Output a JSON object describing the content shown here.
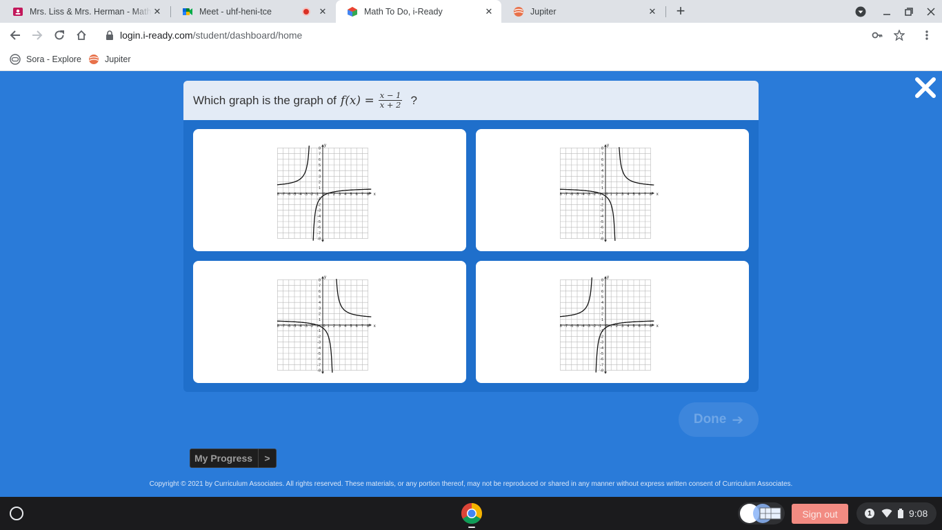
{
  "browser": {
    "tabs": [
      {
        "title": "Mrs. Liss & Mrs. Herman - Math -",
        "icon": "classroom-icon",
        "active": false
      },
      {
        "title": "Meet - uhf-heni-tce",
        "icon": "meet-icon",
        "active": false,
        "recording": true
      },
      {
        "title": "Math To Do, i-Ready",
        "icon": "iready-icon",
        "active": true
      },
      {
        "title": "Jupiter",
        "icon": "jupiter-icon",
        "active": false
      }
    ],
    "url": {
      "domain": "login.i-ready.com",
      "path": "/student/dashboard/home"
    },
    "bookmarks": [
      {
        "label": "Sora - Explore",
        "icon": "sora-icon"
      },
      {
        "label": "Jupiter",
        "icon": "jupiter-icon"
      }
    ]
  },
  "question": {
    "prefix": "Which graph is the graph of",
    "function_name": "f(x) =",
    "numerator": "x − 1",
    "denominator": "x + 2",
    "suffix": "?"
  },
  "choices": [
    {
      "id": "A",
      "left_branch": "above",
      "right_branch": "below"
    },
    {
      "id": "B",
      "left_branch": "below",
      "right_branch": "above"
    },
    {
      "id": "C",
      "left_branch": "below",
      "right_branch": "above"
    },
    {
      "id": "D",
      "left_branch": "above",
      "right_branch": "below"
    }
  ],
  "graph": {
    "axis_labels": {
      "x": "x",
      "y": "y"
    },
    "x_ticks": [
      "-8",
      "-7",
      "-6",
      "-5",
      "-4",
      "-3",
      "-2",
      "-1",
      "0",
      "1",
      "2",
      "3",
      "4",
      "5",
      "6",
      "7",
      "8"
    ],
    "y_ticks": [
      "8",
      "7",
      "6",
      "5",
      "4",
      "3",
      "2",
      "1",
      "-1",
      "-2",
      "-3",
      "-4",
      "-5",
      "-6",
      "-7",
      "-8"
    ]
  },
  "buttons": {
    "done": "Done",
    "my_progress": "My Progress",
    "my_progress_arrow": ">"
  },
  "footer": {
    "copyright": "Copyright © 2021 by Curriculum Associates. All rights reserved. These materials, or any portion thereof, may not be reproduced or shared in any manner without express written consent of Curriculum Associates."
  },
  "shelf": {
    "signout": "Sign out",
    "notification_count": "1",
    "time": "9:08"
  },
  "colors": {
    "page_bg": "#2a7bd9",
    "card_bg": "#1f6fcb",
    "header_bg": "#e3ebf6",
    "signout_bg": "#f28b82"
  }
}
